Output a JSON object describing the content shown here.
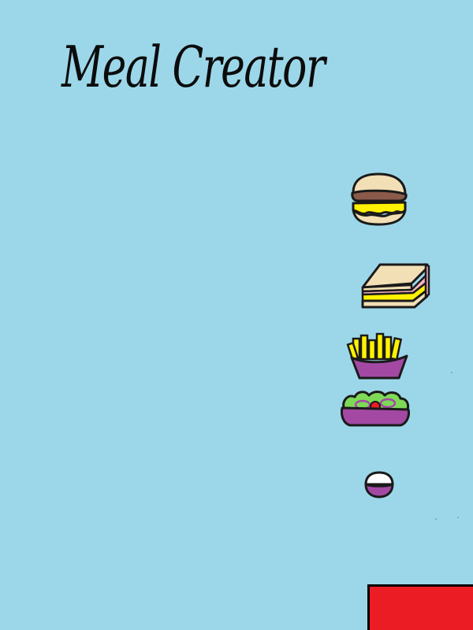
{
  "title": "Meal Creator",
  "menu": {
    "items": [
      {
        "id": "burger",
        "icon": "burger-icon"
      },
      {
        "id": "sandwich",
        "icon": "sandwich-icon"
      },
      {
        "id": "fries",
        "icon": "fries-icon"
      },
      {
        "id": "salad",
        "icon": "salad-icon"
      },
      {
        "id": "rice-ball",
        "icon": "rice-ball-icon"
      }
    ]
  },
  "colors": {
    "background": "#9cd7e9",
    "button": "#ec1c24",
    "bun": "#f2dfb5",
    "patty": "#8b5a4a",
    "cheese": "#fff200",
    "ham": "#f7b3c2",
    "container": "#a349a4",
    "lettuce": "#7ed957",
    "tomato": "#ed1c24",
    "outline": "#1a1a1a"
  }
}
